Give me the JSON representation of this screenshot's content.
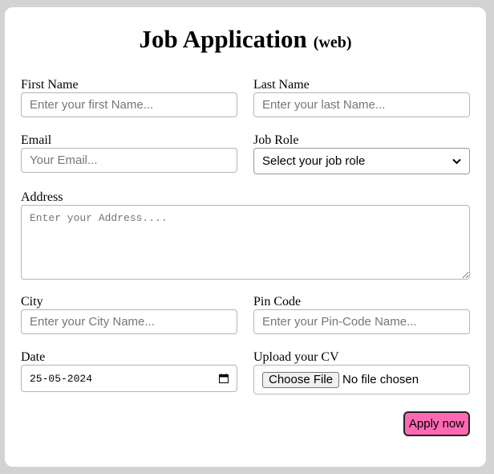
{
  "form": {
    "title": "Job Application",
    "subtitle": "(web)",
    "first_name": {
      "label": "First Name",
      "placeholder": "Enter your first Name..."
    },
    "last_name": {
      "label": "Last Name",
      "placeholder": "Enter your last Name..."
    },
    "email": {
      "label": "Email",
      "placeholder": "Your Email..."
    },
    "job_role": {
      "label": "Job Role",
      "selected": "Select your job role"
    },
    "address": {
      "label": "Address",
      "placeholder": "Enter your Address...."
    },
    "city": {
      "label": "City",
      "placeholder": "Enter your City Name..."
    },
    "pin_code": {
      "label": "Pin Code",
      "placeholder": "Enter your Pin-Code Name..."
    },
    "date": {
      "label": "Date",
      "value": "25-05-2024"
    },
    "cv": {
      "label": "Upload your CV",
      "button": "Choose File",
      "status": "No file chosen"
    },
    "apply_label": "Apply now"
  },
  "icons": {
    "select_chevron": "chevron-down-icon",
    "date_picker": "calendar-icon"
  },
  "colors": {
    "page_background": "#d3d3d3",
    "card_background": "#ffffff",
    "apply_button": "#ff69b4"
  }
}
